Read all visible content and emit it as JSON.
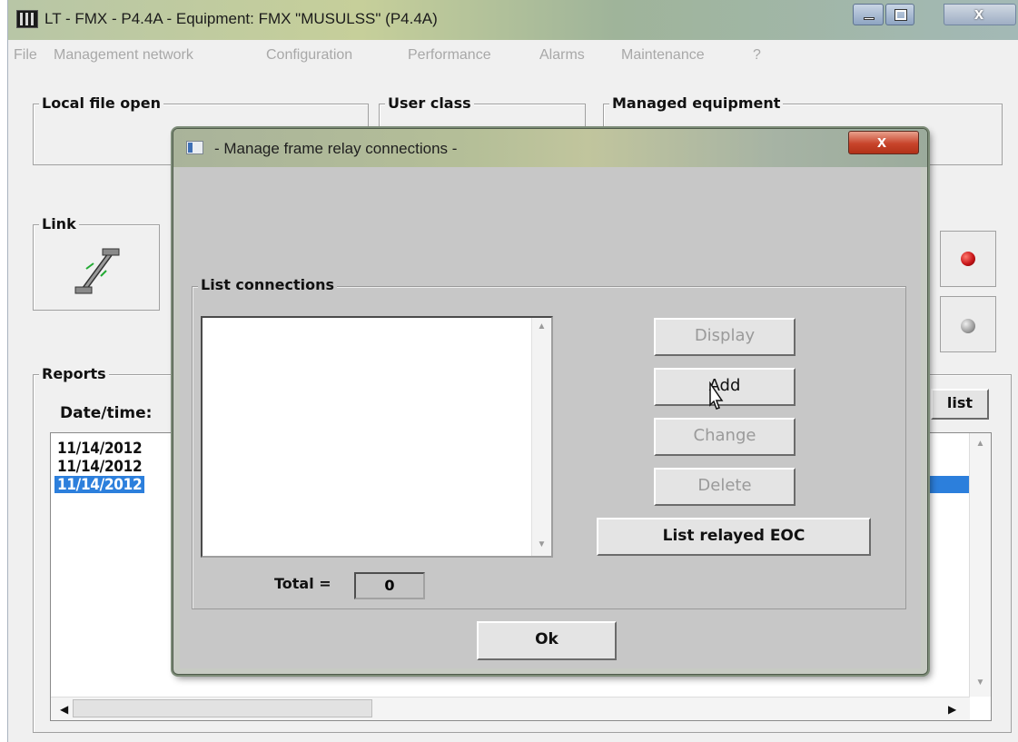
{
  "window": {
    "title": "LT - FMX - P4.4A - Equipment: FMX \"MUSULSS\" (P4.4A)",
    "close_glyph": "x"
  },
  "menu": [
    "File",
    "Management network",
    "Configuration",
    "Performance",
    "Alarms",
    "Maintenance",
    "?"
  ],
  "groups": {
    "local_file": "Local file open",
    "user_class": "User class",
    "managed_equipment": "Managed equipment",
    "link": "Link",
    "reports": "Reports"
  },
  "reports": {
    "date_label": "Date/time:",
    "list_button": "list",
    "rows": [
      "11/14/2012",
      "11/14/2012",
      "11/14/2012"
    ],
    "selected_index": 2
  },
  "indicators": {
    "top_color": "#c8161a",
    "bottom_color": "#9b9b9b"
  },
  "dialog": {
    "title": "- Manage frame relay connections -",
    "close_glyph": "x",
    "list_group_label": "List connections",
    "buttons": {
      "display": "Display",
      "add": "Add",
      "change": "Change",
      "delete": "Delete",
      "list_relayed": "List relayed EOC",
      "ok": "Ok"
    },
    "total_label": "Total =",
    "total_value": "0",
    "connections": []
  },
  "colors": {
    "selection": "#2c7fdc",
    "dialog_close": "#c8442b"
  }
}
